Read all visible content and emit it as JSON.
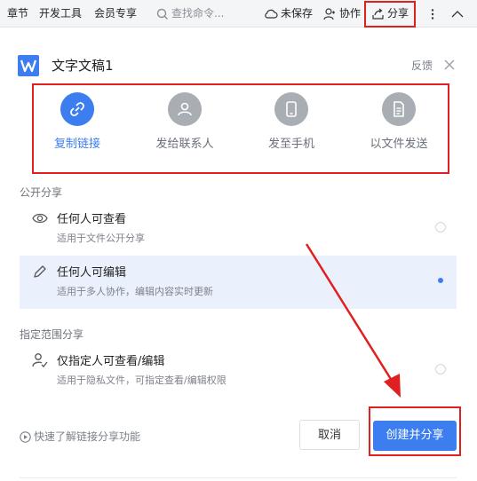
{
  "toolbar": {
    "chapter": "章节",
    "devtools": "开发工具",
    "member": "会员专享",
    "search_placeholder": "查找命令...",
    "unsaved": "未保存",
    "collab": "协作",
    "share": "分享"
  },
  "dialog": {
    "title": "文字文稿1",
    "feedback": "反馈",
    "share_options": [
      {
        "label": "复制链接",
        "icon": "link-icon",
        "active": true
      },
      {
        "label": "发给联系人",
        "icon": "contact-icon",
        "active": false
      },
      {
        "label": "发至手机",
        "icon": "phone-icon",
        "active": false
      },
      {
        "label": "以文件发送",
        "icon": "file-icon",
        "active": false
      }
    ],
    "public_section": "公开分享",
    "perm": [
      {
        "title": "任何人可查看",
        "desc": "适用于文件公开分享",
        "icon": "eye-icon",
        "selected": false
      },
      {
        "title": "任何人可编辑",
        "desc": "适用于多人协作，编辑内容实时更新",
        "icon": "pencil-icon",
        "selected": true
      }
    ],
    "scope_section": "指定范围分享",
    "scope": {
      "title": "仅指定人可查看/编辑",
      "desc": "适用于隐私文件，可指定查看/编辑权限",
      "icon": "user-check-icon",
      "selected": false
    },
    "help": "快速了解链接分享功能",
    "cancel": "取消",
    "create": "创建并分享"
  },
  "colors": {
    "accent": "#3c7ef0",
    "highlight": "#e02020"
  }
}
